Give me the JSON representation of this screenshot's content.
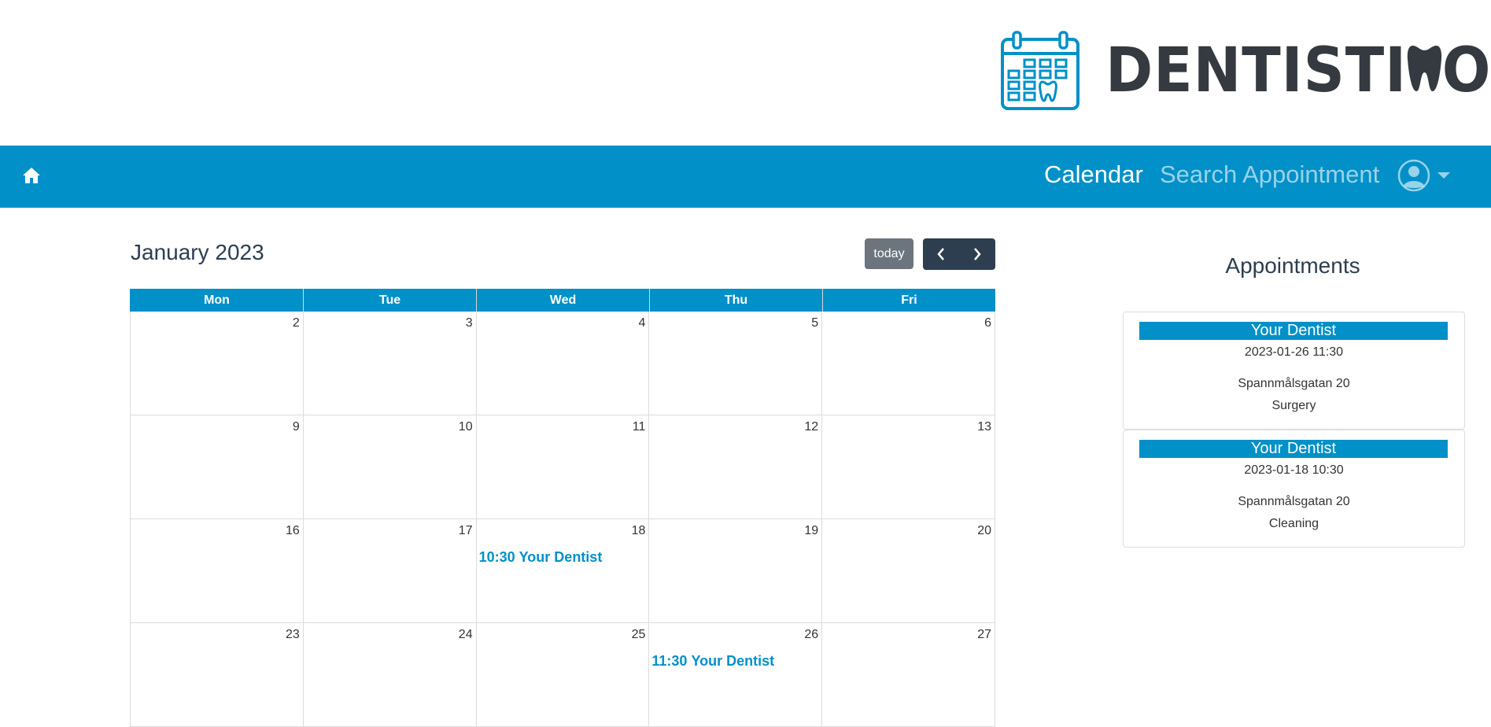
{
  "brand": {
    "logo_text": "DENTISTI",
    "logo_text_end": "O"
  },
  "nav": {
    "calendar_label": "Calendar",
    "search_label": "Search Appointment",
    "accent_color": "#0190c8"
  },
  "calendar": {
    "title": "January 2023",
    "today_label": "today",
    "day_headers": [
      "Mon",
      "Tue",
      "Wed",
      "Thu",
      "Fri"
    ],
    "weeks": [
      [
        {
          "day": "2"
        },
        {
          "day": "3"
        },
        {
          "day": "4"
        },
        {
          "day": "5"
        },
        {
          "day": "6"
        }
      ],
      [
        {
          "day": "9"
        },
        {
          "day": "10"
        },
        {
          "day": "11"
        },
        {
          "day": "12"
        },
        {
          "day": "13"
        }
      ],
      [
        {
          "day": "16"
        },
        {
          "day": "17"
        },
        {
          "day": "18",
          "event": {
            "time": "10:30",
            "title": "Your Dentist"
          }
        },
        {
          "day": "19"
        },
        {
          "day": "20"
        }
      ],
      [
        {
          "day": "23"
        },
        {
          "day": "24"
        },
        {
          "day": "25"
        },
        {
          "day": "26",
          "event": {
            "time": "11:30",
            "title": "Your Dentist"
          }
        },
        {
          "day": "27"
        }
      ]
    ]
  },
  "appointments": {
    "heading": "Appointments",
    "items": [
      {
        "dentist": "Your Dentist",
        "datetime": "2023-01-26 11:30",
        "address": "Spannmålsgatan 20",
        "type": "Surgery"
      },
      {
        "dentist": "Your Dentist",
        "datetime": "2023-01-18 10:30",
        "address": "Spannmålsgatan 20",
        "type": "Cleaning"
      }
    ]
  }
}
